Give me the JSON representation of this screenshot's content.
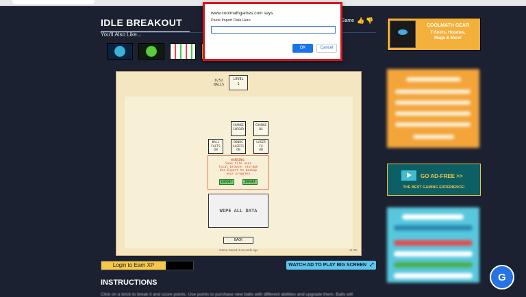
{
  "game": {
    "title": "IDLE BREAKOUT",
    "also_like": "You'll Also Like...",
    "right_label": "Game",
    "balls_label": "0/52\nBALLS",
    "level_label": "LEVEL\n1",
    "buttons": {
      "change_cursor": "CHANGE\nCURSOR",
      "change_bg": "CHANGE\nBG",
      "ball_facts": "BALL\nFACTS\nON",
      "bonus_alerts": "BONUS\nALERTS\nON",
      "laser_fx": "LASER\nFX\nON",
      "export": "EXPORT",
      "import": "IMPORT",
      "wipe": "WIPE ALL DATA",
      "back": "BACK"
    },
    "warning": "WARNING:\nSave file uses\nlocal browser storage\nUse Export to backup\nyour progress",
    "saved_status": "Game Saved 4 seconds ago",
    "version": "v1.09"
  },
  "below": {
    "login_label": "Login to Earn XP",
    "login_progress": 0.7,
    "watch_label": "WATCH AD TO PLAY BIG SCREEN",
    "instructions_heading": "INSTRUCTIONS",
    "instructions_text": "Click on a brick to break it and score points. Use points to purchase new balls with different abilities and upgrade them. Balls will"
  },
  "sidebar": {
    "gear_title": "COOLMATH GEAR",
    "gear_sub": "T-Shirts, Hoodies,\nMugs & More!",
    "adfree_title": "GO AD-FREE >>",
    "adfree_sub": "THE BEST GAMING EXPERIENCE!"
  },
  "dialog": {
    "origin": "www.coolmathgames.com says",
    "message": "Paste Import Data Here",
    "input_value": "",
    "ok_label": "OK",
    "cancel_label": "Cancel"
  },
  "watermark": {
    "logo_text": "G"
  },
  "colors": {
    "background": "#1b2130",
    "dialog_border": "#d8171e",
    "accent_blue": "#1a73e8"
  }
}
